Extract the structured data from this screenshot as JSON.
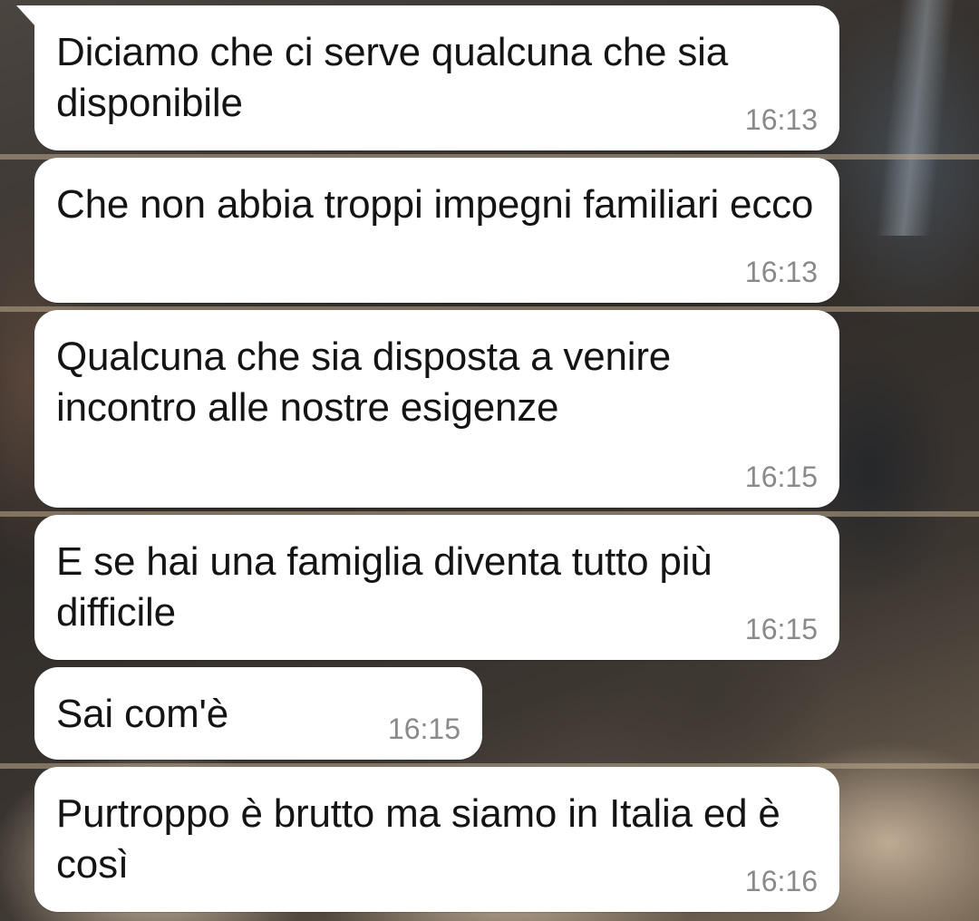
{
  "messages": [
    {
      "text": "Diciamo che ci serve qualcuna che sia disponibile",
      "time": "16:13"
    },
    {
      "text": "Che non abbia troppi impegni familiari ecco",
      "time": "16:13"
    },
    {
      "text": "Qualcuna che sia disposta a venire incontro alle nostre esigenze",
      "time": "16:15"
    },
    {
      "text": "E se hai una famiglia diventa tutto più difficile",
      "time": "16:15"
    },
    {
      "text": "Sai com'è",
      "time": "16:15"
    },
    {
      "text": "Purtroppo è brutto ma siamo in Italia ed è così",
      "time": "16:16"
    }
  ],
  "colors": {
    "bubble_bg": "#ffffff",
    "message_text": "#141414",
    "timestamp_text": "#8a8a8a"
  }
}
